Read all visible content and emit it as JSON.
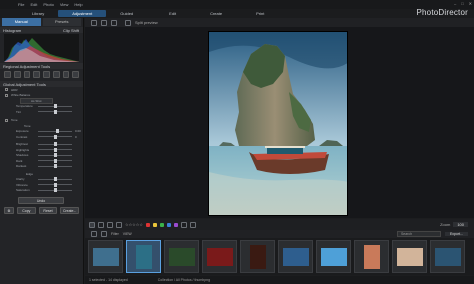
{
  "app": {
    "brand": "PhotoDirector"
  },
  "menu": [
    "File",
    "Edit",
    "Photo",
    "View",
    "Help"
  ],
  "window_controls": [
    "–",
    "□",
    "✕"
  ],
  "modes": [
    {
      "label": "Library",
      "active": false
    },
    {
      "label": "Adjustment",
      "active": true
    },
    {
      "label": "Guided",
      "active": false
    },
    {
      "label": "Edit",
      "active": false
    },
    {
      "label": "Create",
      "active": false
    },
    {
      "label": "Print",
      "active": false
    }
  ],
  "left_panel": {
    "tabs": [
      {
        "label": "Manual",
        "active": true
      },
      {
        "label": "Presets",
        "active": false
      }
    ],
    "histogram": {
      "title": "Histogram",
      "right_labels": "Clip  Shift"
    },
    "regional": {
      "title": "Regional Adjustment Tools"
    },
    "global": {
      "title": "Global Adjustment Tools"
    },
    "tools": [
      {
        "title": "HDR"
      },
      {
        "title": "White Balance"
      }
    ],
    "wb_mode": "As Shot",
    "wb_sliders": [
      {
        "label": "Temperature",
        "value": 0.5
      },
      {
        "label": "Tint",
        "value": 0.5
      }
    ],
    "tone_title": "Tone",
    "tone_sub": "Tone",
    "tone_sliders": [
      {
        "label": "Exposure",
        "value": 0.55,
        "display": "0.00"
      },
      {
        "label": "Contrast",
        "value": 0.5,
        "display": "0"
      }
    ],
    "tone_sliders2": [
      {
        "label": "Brightest",
        "value": 0.5
      },
      {
        "label": "Highlights",
        "value": 0.5
      },
      {
        "label": "Shadows",
        "value": 0.5
      },
      {
        "label": "Dark",
        "value": 0.5
      },
      {
        "label": "Darkest",
        "value": 0.5
      }
    ],
    "edge_title": "Edge",
    "edge_sliders": [
      {
        "label": "Clarity",
        "value": 0.5
      },
      {
        "label": "Vibrance",
        "value": 0.5
      },
      {
        "label": "Saturation",
        "value": 0.5
      }
    ],
    "undo_label": "Undo",
    "buttons": [
      "Copy",
      "Reset",
      "Create..."
    ]
  },
  "top_toolbar": {
    "split_label": "Split preview"
  },
  "view_toolbar": {
    "zoom_label": "Zoom",
    "zoom_value": "100"
  },
  "filmstrip_toolbar": {
    "filter_label": "Filter",
    "view_label": "VIEW",
    "search_placeholder": "Search",
    "export_label": "Export..."
  },
  "thumbnails": [
    "#3f6f8e",
    "#2c6f86",
    "#2a4a2a",
    "#7a1a1a",
    "#3a1a12",
    "#2e5e8e",
    "#4ea0d8",
    "#c97a5a",
    "#d2b49a",
    "#2b5472"
  ],
  "status": {
    "left": "1 selected - 14 displayed",
    "middle": "Collection / All Photos / thumbpng"
  },
  "colors": {
    "accent": "#3c6fa3"
  }
}
